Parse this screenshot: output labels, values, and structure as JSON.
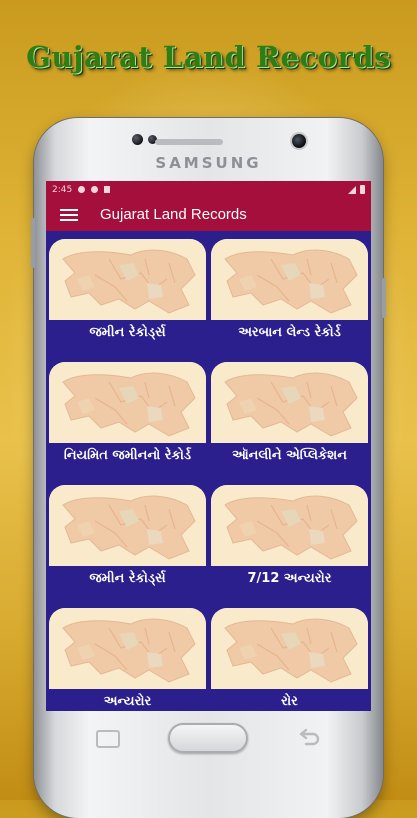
{
  "promo": {
    "title": "Gujarat Land Records"
  },
  "device": {
    "brand": "SAMSUNG"
  },
  "status_bar": {
    "time": "2:45"
  },
  "app_bar": {
    "title": "Gujarat Land Records"
  },
  "colors": {
    "primary": "#a40f3b",
    "card_label_bg": "#2a1f8d",
    "map_bg": "#f9eacb"
  },
  "menu_tiles": [
    {
      "label": "જમીન રેકોર્ડ્સ"
    },
    {
      "label": "અરબાન લેન્ડ રેકોર્ડ"
    },
    {
      "label": "નિયમિત જમીનનો રેકોર્ડ"
    },
    {
      "label": "ઑનલીને એપ્લિકેશન"
    },
    {
      "label": "જમીન રેકોર્ડ્સ"
    },
    {
      "label": "7/12 અન્યરોર"
    },
    {
      "label": "અન્યરોર"
    },
    {
      "label": "રોર"
    }
  ]
}
